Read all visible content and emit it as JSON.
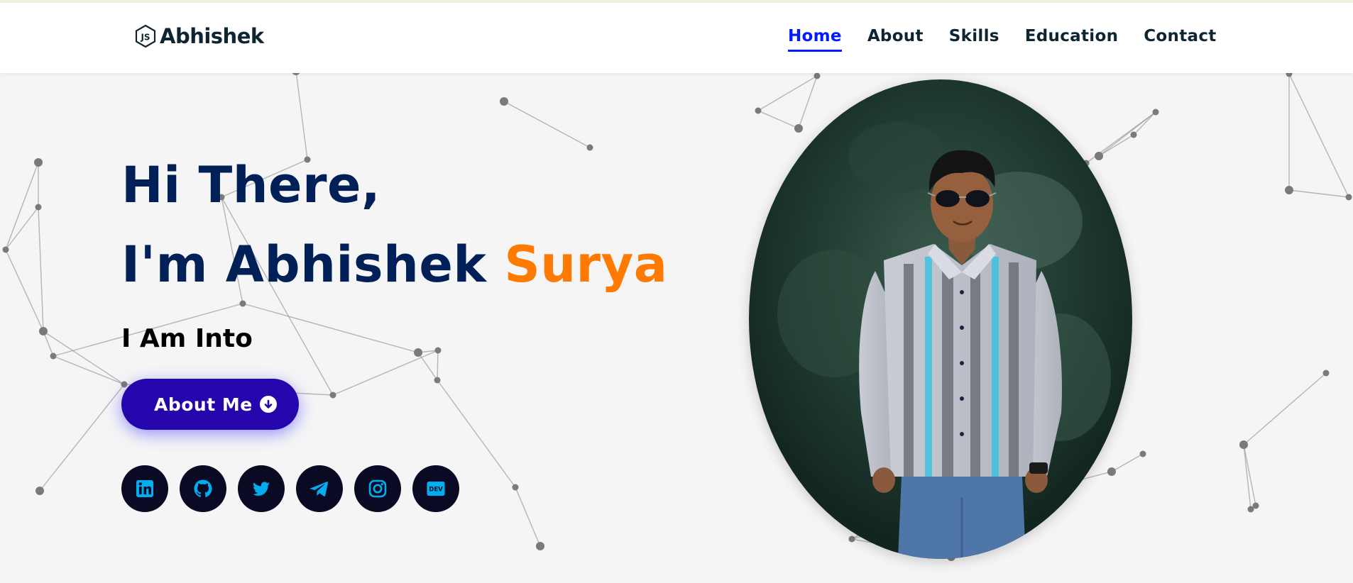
{
  "brand": {
    "name": "Abhishek",
    "icon": "nodejs-hexagon-icon"
  },
  "nav": [
    {
      "label": "Home",
      "active": true
    },
    {
      "label": "About",
      "active": false
    },
    {
      "label": "Skills",
      "active": false
    },
    {
      "label": "Education",
      "active": false
    },
    {
      "label": "Contact",
      "active": false
    }
  ],
  "hero": {
    "line1": "Hi There,",
    "line2_prefix": "I'm Abhishek",
    "line2_accent": "Surya",
    "subtitle": "I Am Into",
    "button_label": "About Me",
    "button_icon": "arrow-circle-down-icon",
    "photo_icon": "profile-photo"
  },
  "socials": [
    {
      "name": "linkedin",
      "icon": "linkedin-icon"
    },
    {
      "name": "github",
      "icon": "github-icon"
    },
    {
      "name": "twitter",
      "icon": "twitter-icon"
    },
    {
      "name": "telegram",
      "icon": "telegram-icon"
    },
    {
      "name": "instagram",
      "icon": "instagram-icon"
    },
    {
      "name": "dev",
      "icon": "dev-icon",
      "label": "DEV"
    }
  ],
  "colors": {
    "primary": "#002057",
    "accent": "#ff7a00",
    "nav_active": "#011aff",
    "button": "#2506ad",
    "social_bg": "#0b0a24",
    "social_icon": "#00aeef"
  }
}
